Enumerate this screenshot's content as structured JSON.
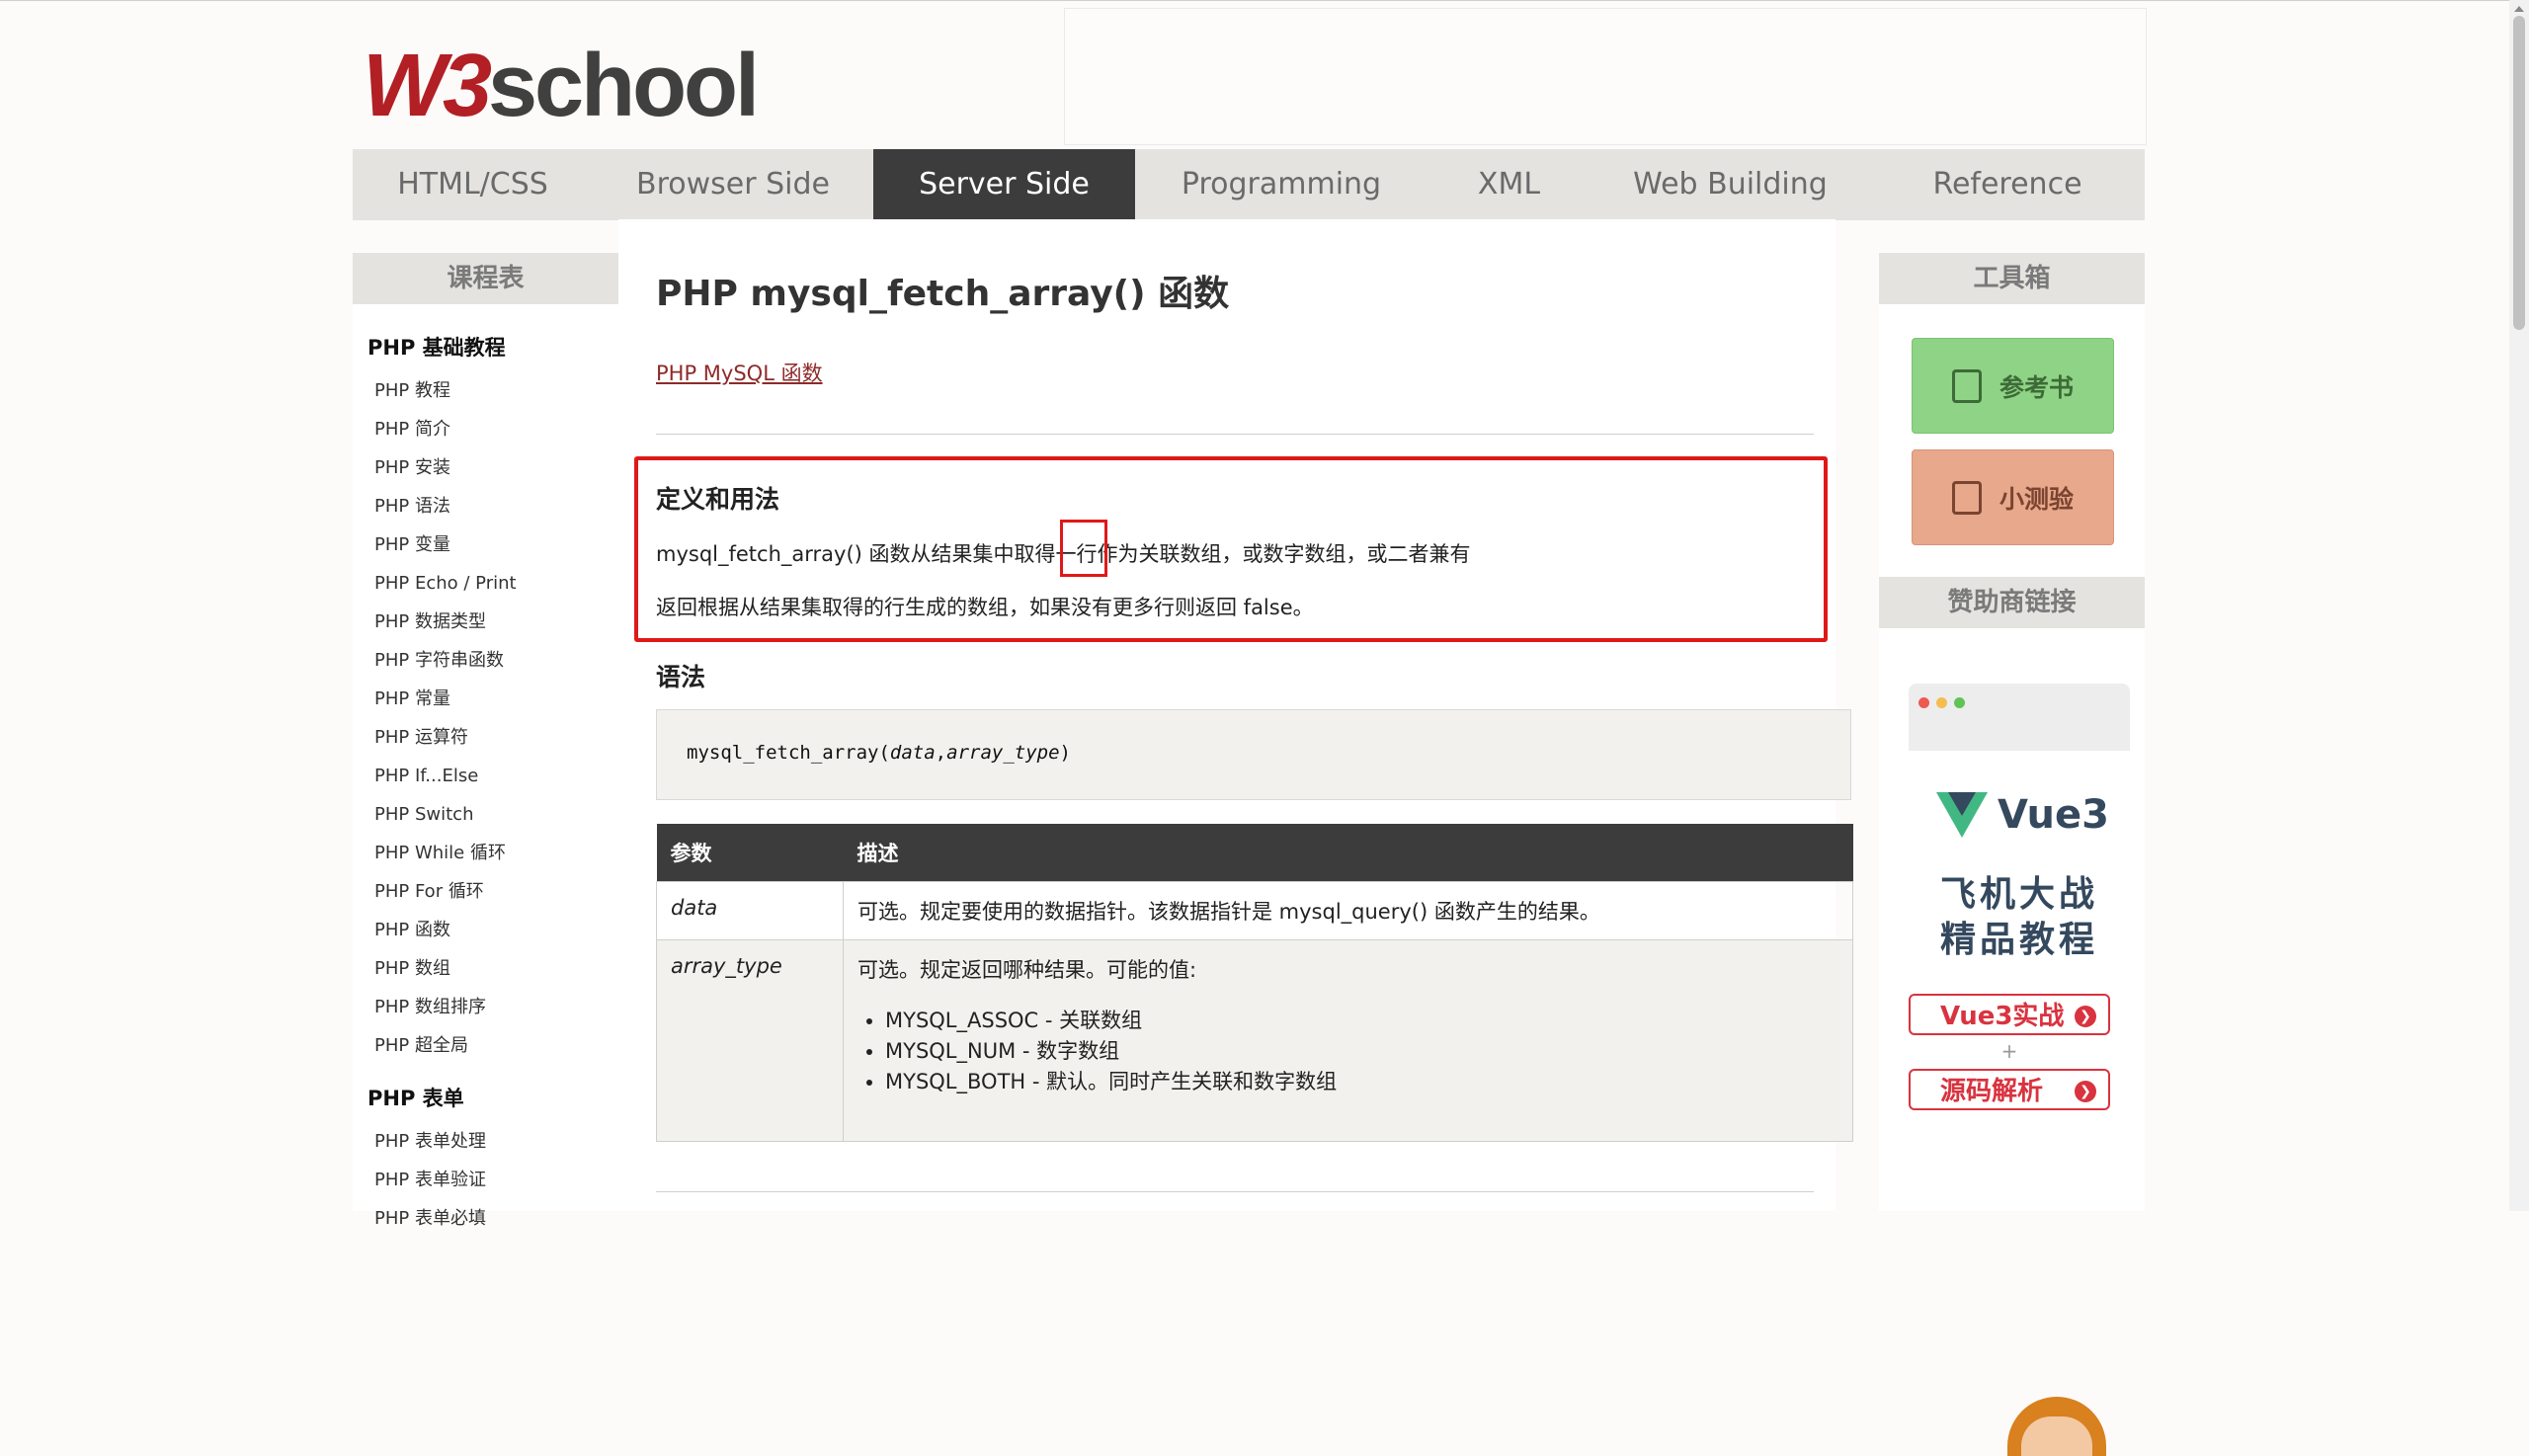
{
  "header": {
    "logo_w3": "W3",
    "logo_school": "school"
  },
  "nav": {
    "items": [
      "HTML/CSS",
      "Browser Side",
      "Server Side",
      "Programming",
      "XML",
      "Web Building",
      "Reference"
    ],
    "active": "Server Side"
  },
  "sidebar": {
    "title": "课程表",
    "groups": [
      {
        "title": "PHP 基础教程",
        "items": [
          "PHP 教程",
          "PHP 简介",
          "PHP 安装",
          "PHP 语法",
          "PHP 变量",
          "PHP Echo / Print",
          "PHP 数据类型",
          "PHP 字符串函数",
          "PHP 常量",
          "PHP 运算符",
          "PHP If...Else",
          "PHP Switch",
          "PHP While 循环",
          "PHP For 循环",
          "PHP 函数",
          "PHP 数组",
          "PHP 数组排序",
          "PHP 超全局"
        ]
      },
      {
        "title": "PHP 表单",
        "items": [
          "PHP 表单处理",
          "PHP 表单验证",
          "PHP 表单必填"
        ]
      }
    ]
  },
  "main": {
    "title": "PHP mysql_fetch_array() 函数",
    "breadcrumb": "PHP MySQL 函数",
    "definition": {
      "heading": "定义和用法",
      "line1": "mysql_fetch_array() 函数从结果集中取得一行作为关联数组，或数字数组，或二者兼有",
      "line2": "返回根据从结果集取得的行生成的数组，如果没有更多行则返回 false。"
    },
    "syntax": {
      "heading": "语法",
      "fn": "mysql_fetch_array(",
      "arg1": "data",
      "sep": ",",
      "arg2": "array_type",
      "close": ")"
    },
    "table": {
      "headers": [
        "参数",
        "描述"
      ],
      "rows": [
        {
          "param": "data",
          "desc": "可选。规定要使用的数据指针。该数据指针是 mysql_query() 函数产生的结果。"
        },
        {
          "param": "array_type",
          "desc": "可选。规定返回哪种结果。可能的值:",
          "options": [
            "MYSQL_ASSOC - 关联数组",
            "MYSQL_NUM - 数字数组",
            "MYSQL_BOTH - 默认。同时产生关联和数字数组"
          ]
        }
      ]
    }
  },
  "right": {
    "toolbox_title": "工具箱",
    "reference_btn": "参考书",
    "quiz_btn": "小测验",
    "sponsor_title": "赞助商链接",
    "ad": {
      "brand": "Vue3",
      "line1": "飞机大战",
      "line2": "精品教程",
      "btn1": "Vue3实战",
      "plus": "+",
      "btn2": "源码解析"
    }
  },
  "colors": {
    "brand_red": "#b21f24",
    "nav_active_bg": "#3c3c3c",
    "highlight_border": "#e01818",
    "ref_green": "#8fd386",
    "quiz_orange": "#e8a88c"
  }
}
